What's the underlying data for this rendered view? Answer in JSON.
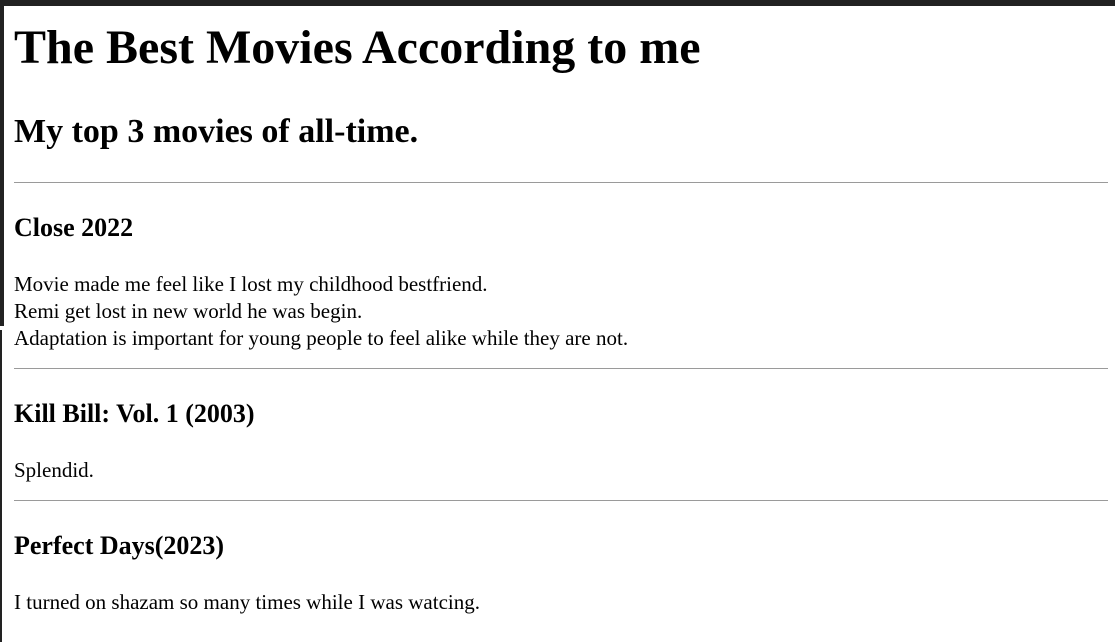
{
  "page": {
    "title": "The Best Movies According to me",
    "subtitle": "My top 3 movies of all-time."
  },
  "movies": [
    {
      "title": "Close 2022",
      "lines": [
        "Movie made me feel like I lost my childhood bestfriend.",
        "Remi get lost in new world he was begin.",
        "Adaptation is important for young people to feel alike while they are not."
      ]
    },
    {
      "title": "Kill Bill: Vol. 1 (2003)",
      "lines": [
        "Splendid."
      ]
    },
    {
      "title": "Perfect Days(2023)",
      "lines": [
        "I turned on shazam so many times while I was watcing."
      ]
    }
  ]
}
